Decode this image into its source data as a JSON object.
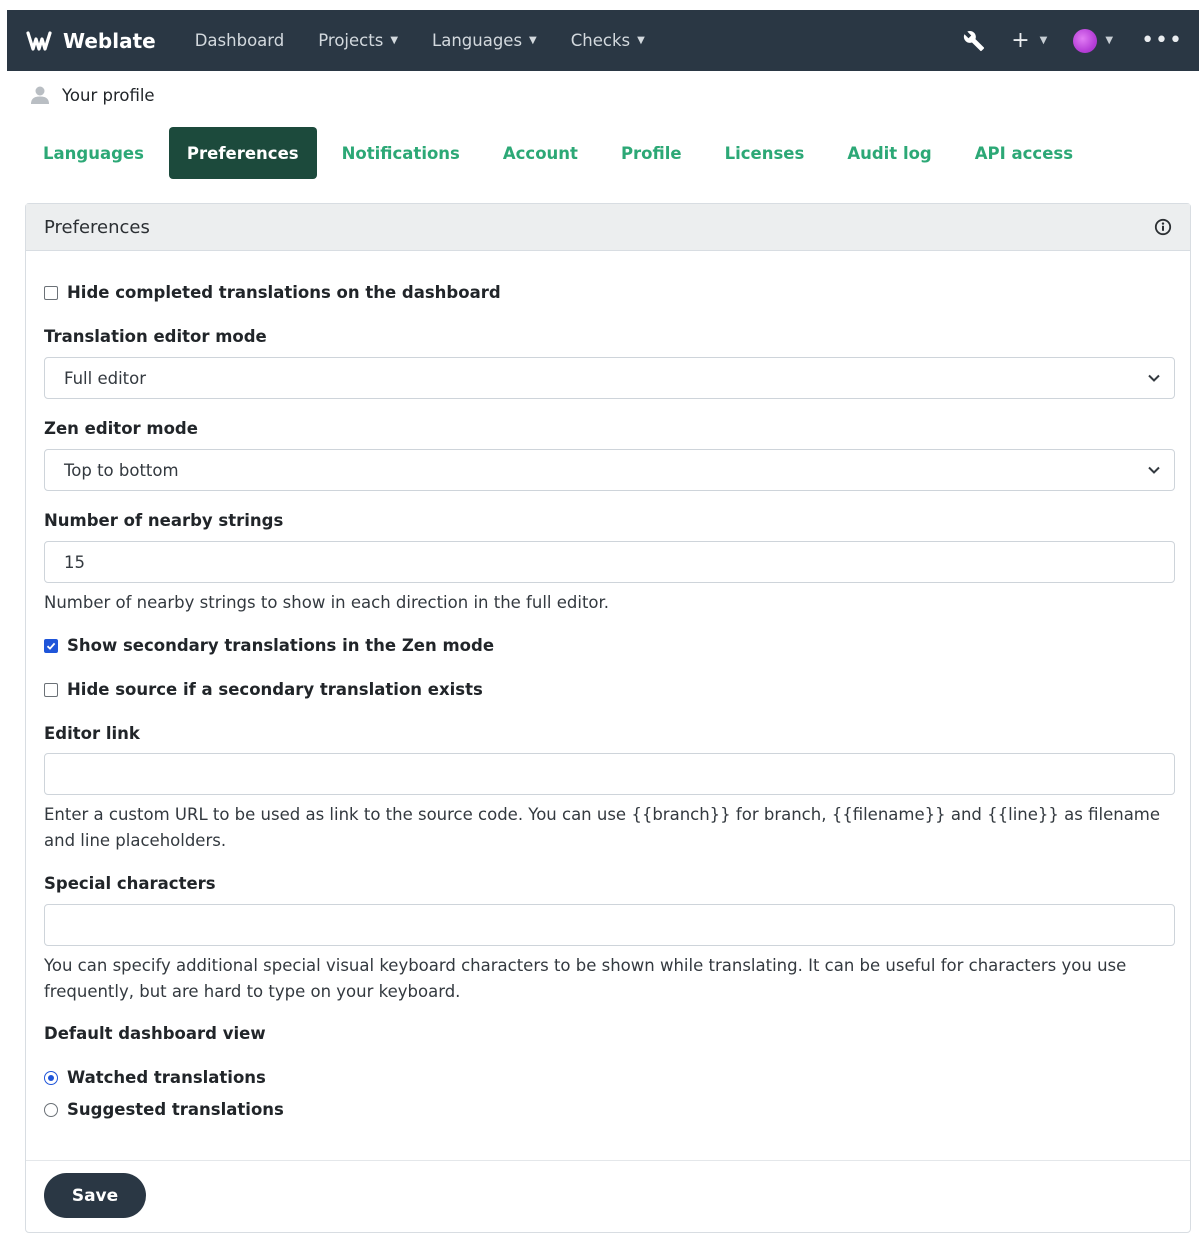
{
  "navbar": {
    "brand": "Weblate",
    "links": {
      "dashboard": "Dashboard",
      "projects": "Projects",
      "languages": "Languages",
      "checks": "Checks"
    },
    "plus": "+"
  },
  "breadcrumb": {
    "label": "Your profile"
  },
  "tabs": {
    "languages": "Languages",
    "preferences": "Preferences",
    "notifications": "Notifications",
    "account": "Account",
    "profile": "Profile",
    "licenses": "Licenses",
    "audit_log": "Audit log",
    "api_access": "API access"
  },
  "card": {
    "title": "Preferences",
    "hide_completed": {
      "label": "Hide completed translations on the dashboard",
      "checked": false
    },
    "editor_mode": {
      "label": "Translation editor mode",
      "value": "Full editor"
    },
    "zen_mode": {
      "label": "Zen editor mode",
      "value": "Top to bottom"
    },
    "nearby": {
      "label": "Number of nearby strings",
      "value": "15",
      "help": "Number of nearby strings to show in each direction in the full editor."
    },
    "secondary_zen": {
      "label": "Show secondary translations in the Zen mode",
      "checked": true
    },
    "hide_source": {
      "label": "Hide source if a secondary translation exists",
      "checked": false
    },
    "editor_link": {
      "label": "Editor link",
      "value": "",
      "help": "Enter a custom URL to be used as link to the source code. You can use {{branch}} for branch, {{filename}} and {{line}} as filename and line placeholders."
    },
    "special_chars": {
      "label": "Special characters",
      "value": "",
      "help": "You can specify additional special visual keyboard characters to be shown while translating. It can be useful for characters you use frequently, but are hard to type on your keyboard."
    },
    "dashboard_view": {
      "label": "Default dashboard view",
      "options": [
        "Watched translations",
        "Suggested translations"
      ],
      "selected": "Watched translations"
    },
    "save_label": "Save"
  },
  "colors": {
    "navbar": "#2a3744",
    "accent": "#2ca876",
    "active_tab": "#1c4a3c",
    "checkbox": "#1f55d9"
  }
}
